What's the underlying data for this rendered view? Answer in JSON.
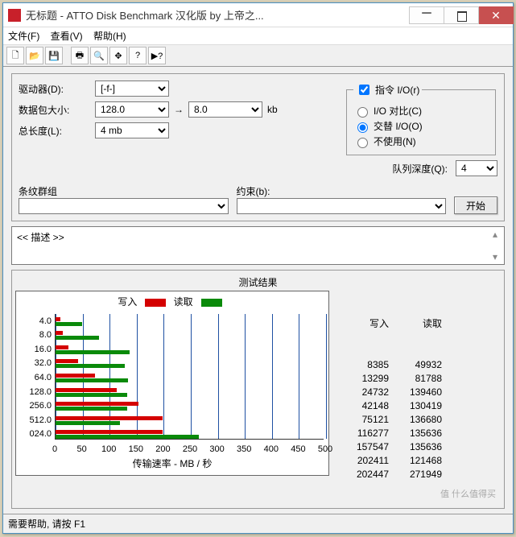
{
  "window": {
    "title": "无标题 - ATTO Disk Benchmark 汉化版 by 上帝之..."
  },
  "menu": {
    "file": "文件(F)",
    "view": "查看(V)",
    "help": "帮助(H)"
  },
  "form": {
    "drive_label": "驱动器(D):",
    "drive_value": "[-f-]",
    "packet_label": "数据包大小:",
    "packet_from": "128.0",
    "packet_to": "8.0",
    "packet_unit": "kb",
    "arrow": "→",
    "length_label": "总长度(L):",
    "length_value": "4 mb",
    "io_legend": "指令 I/O(r)",
    "io_checked": true,
    "r1": "I/O 对比(C)",
    "r2": "交替 I/O(O)",
    "r3": "不使用(N)",
    "r_selected": 2,
    "queue_label": "队列深度(Q):",
    "queue_value": "4",
    "stripe_label": "条纹群组",
    "constraint_label": "约束(b):",
    "start": "开始",
    "desc": "<< 描述 >>"
  },
  "results": {
    "title": "测试结果",
    "write_lbl": "写入",
    "read_lbl": "读取",
    "xaxis": "传输速率 - MB / 秒"
  },
  "chart_data": {
    "type": "bar",
    "title": "测试结果",
    "xlabel": "传输速率 - MB / 秒",
    "ylabel": "",
    "xlim": [
      0,
      500
    ],
    "xticks": [
      0,
      50,
      100,
      150,
      200,
      250,
      300,
      350,
      400,
      450,
      500
    ],
    "categories": [
      "4.0",
      "8.0",
      "16.0",
      "32.0",
      "64.0",
      "128.0",
      "256.0",
      "512.0",
      "024.0"
    ],
    "series": [
      {
        "name": "写入",
        "color": "#d40000",
        "values_kb": [
          8385,
          13299,
          24732,
          42148,
          75121,
          116277,
          157547,
          202411,
          202447
        ]
      },
      {
        "name": "读取",
        "color": "#0a8a0a",
        "values_kb": [
          49932,
          81788,
          139460,
          130419,
          136680,
          135636,
          135636,
          121468,
          271949
        ]
      }
    ]
  },
  "status": "需要帮助, 请按 F1",
  "watermark": "值 什么值得买"
}
